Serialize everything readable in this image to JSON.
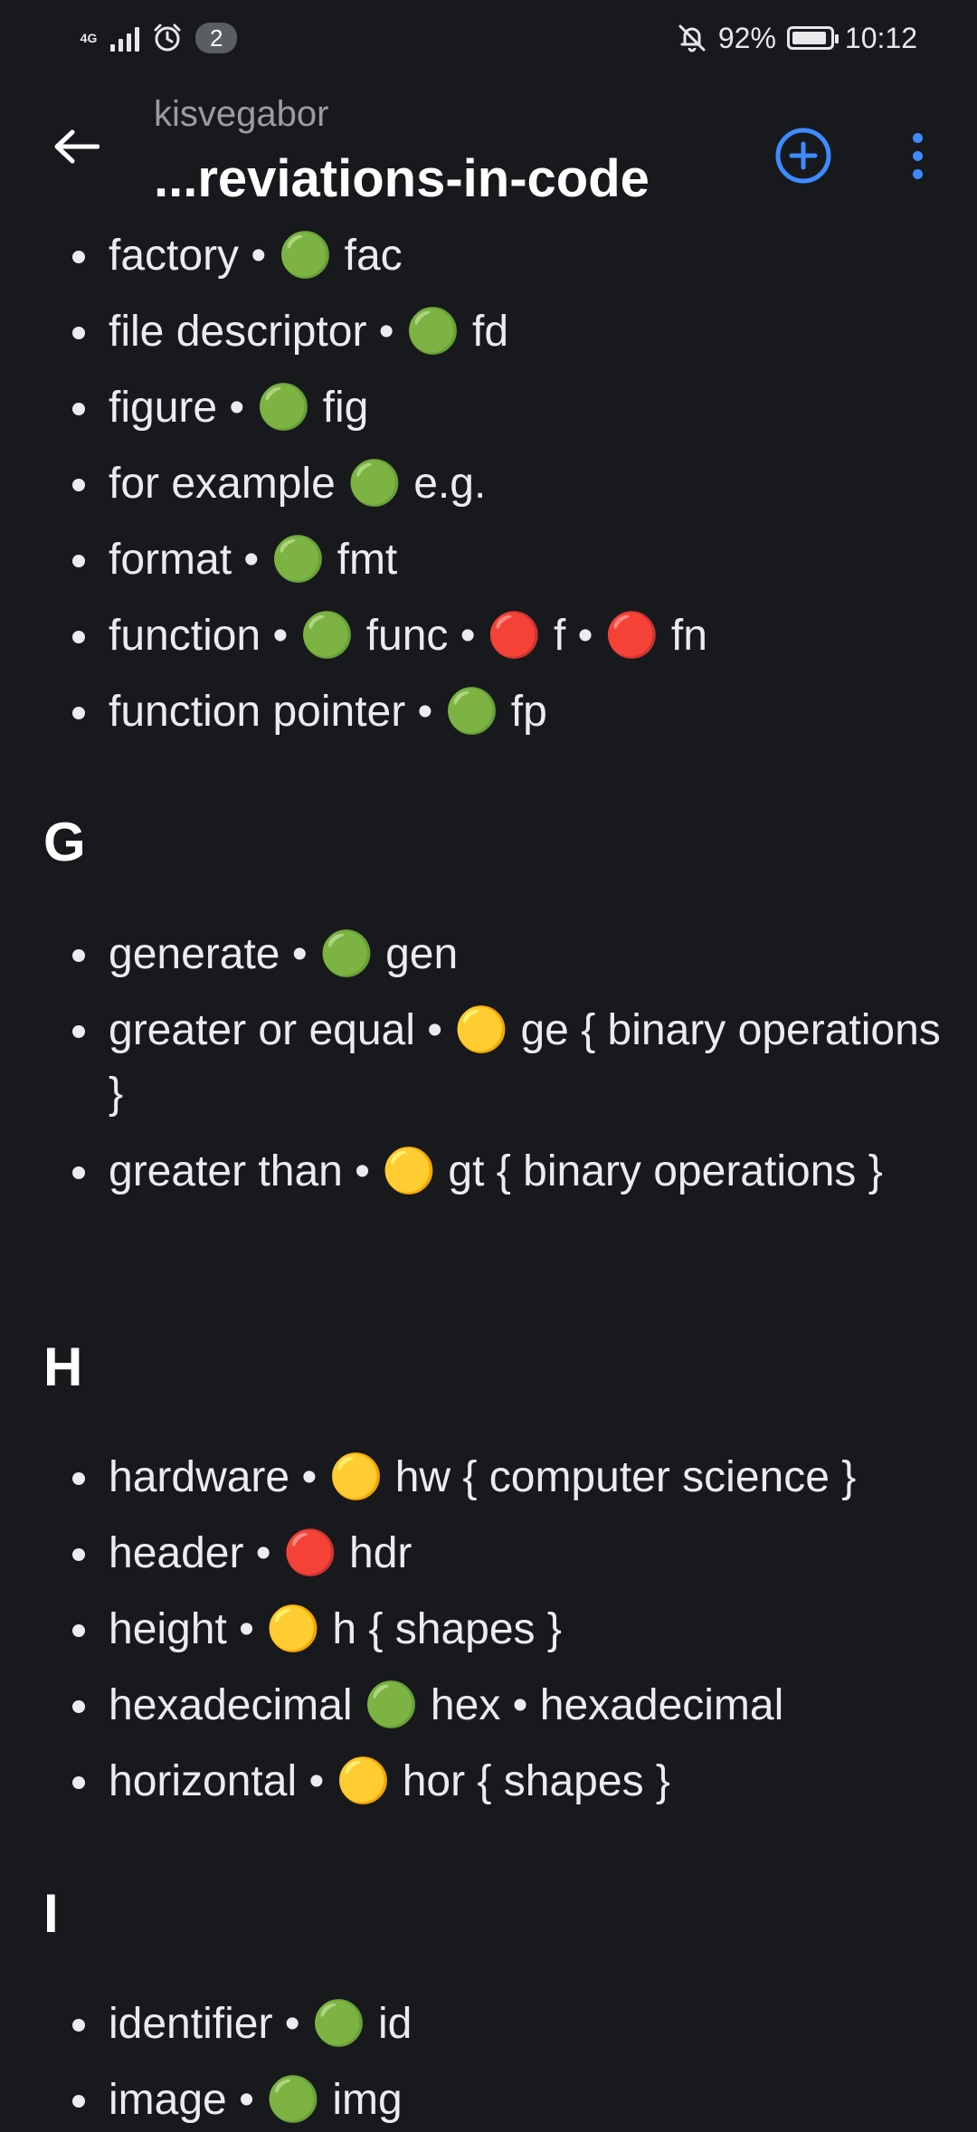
{
  "status_bar": {
    "network": "4G",
    "notification_count": "2",
    "battery": "92%",
    "time": "10:12",
    "battery_level": 0.92
  },
  "app_bar": {
    "subtitle": "kisvegabor",
    "title": "...reviations-in-code",
    "accent_color": "#3d8cff"
  },
  "sections": {
    "f_items": [
      "factory • 🟢 fac",
      "file descriptor • 🟢 fd",
      "figure • 🟢 fig",
      "for example 🟢 e.g.",
      "format • 🟢 fmt",
      "function • 🟢 func • 🔴 f • 🔴 fn",
      "function pointer • 🟢 fp"
    ],
    "g_heading": "G",
    "g_items": [
      "generate • 🟢 gen",
      "greater or equal • 🟡 ge { binary operations }",
      "greater than • 🟡 gt { binary operations }"
    ],
    "h_heading": "H",
    "h_items": [
      "hardware • 🟡 hw { computer science }",
      "header • 🔴 hdr",
      "height • 🟡 h { shapes }",
      "hexadecimal 🟢 hex • hexadecimal",
      "horizontal • 🟡 hor { shapes }"
    ],
    "i_heading": "I",
    "i_items": [
      "identifier • 🟢 id",
      "image • 🟢 img"
    ]
  }
}
